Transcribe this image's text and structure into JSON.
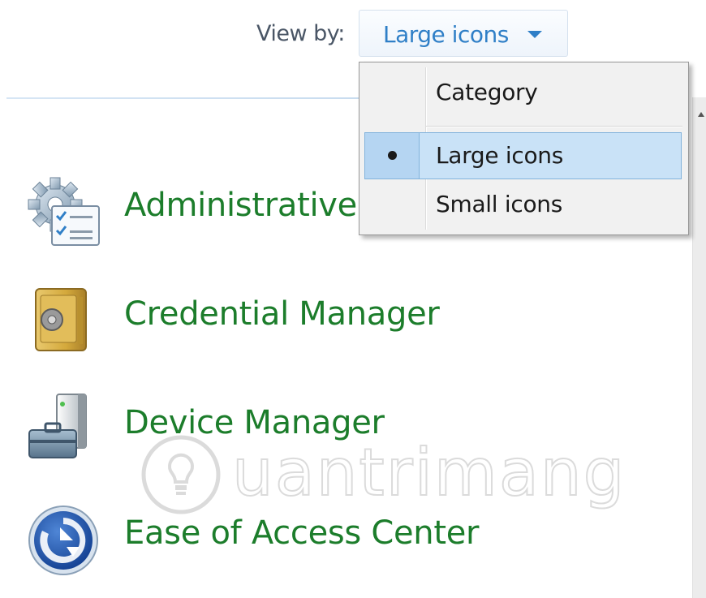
{
  "header": {
    "view_by_label": "View by:",
    "view_by_value": "Large icons"
  },
  "items": [
    {
      "label": "Administrative Tools",
      "icon": "administrative-tools-icon"
    },
    {
      "label": "Credential Manager",
      "icon": "credential-manager-icon"
    },
    {
      "label": "Device Manager",
      "icon": "device-manager-icon"
    },
    {
      "label": "Ease of Access Center",
      "icon": "ease-of-access-icon"
    }
  ],
  "view_menu": {
    "options": [
      {
        "label": "Category",
        "selected": false
      },
      {
        "label": "Large icons",
        "selected": true
      },
      {
        "label": "Small icons",
        "selected": false
      }
    ]
  },
  "watermark": {
    "text": "uantrimang"
  },
  "colors": {
    "link_green": "#1c7d2b",
    "accent_blue": "#2f7fc7",
    "menu_highlight": "#c9e2f7"
  }
}
